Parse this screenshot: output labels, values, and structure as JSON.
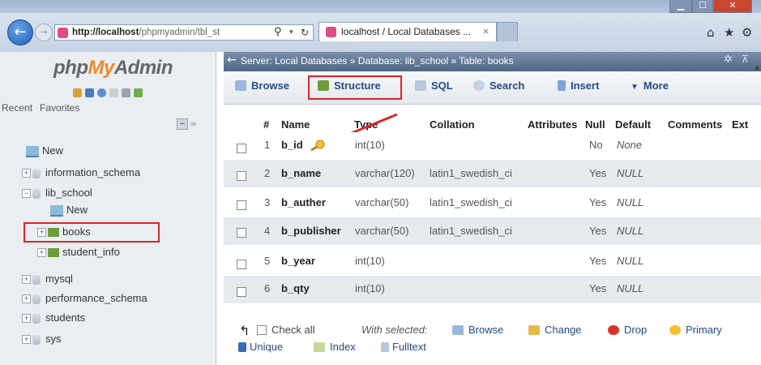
{
  "browser": {
    "url_host": "http://localhost",
    "url_path": "/phpmyadmin/tbl_st",
    "tab_title": "localhost / Local Databases ...",
    "tab_close": "×",
    "back_glyph": "←",
    "fwd_glyph": "→",
    "search_glyph": "⚲",
    "drop_glyph": "▾",
    "refresh_glyph": "↻",
    "home_icon": "⌂",
    "star_icon": "★",
    "gear_icon": "⚙",
    "min_glyph": "▁",
    "max_glyph": "☐",
    "close_glyph": "✕"
  },
  "sidebar": {
    "logo_php": "php",
    "logo_my": "My",
    "logo_admin": "Admin",
    "tabs": [
      "Recent",
      "Favorites"
    ],
    "collapse_glyph": "–",
    "link_glyph": "∞",
    "tree": [
      {
        "label": "New",
        "level": 0,
        "kind": "new"
      },
      {
        "label": "information_schema",
        "level": 0,
        "kind": "db"
      },
      {
        "label": "lib_school",
        "level": 0,
        "kind": "db",
        "expanded": true
      },
      {
        "label": "New",
        "level": 1,
        "kind": "new"
      },
      {
        "label": "books",
        "level": 1,
        "kind": "table",
        "selected": true
      },
      {
        "label": "student_info",
        "level": 1,
        "kind": "table"
      },
      {
        "label": "mysql",
        "level": 0,
        "kind": "db"
      },
      {
        "label": "performance_schema",
        "level": 0,
        "kind": "db"
      },
      {
        "label": "students",
        "level": 0,
        "kind": "db"
      },
      {
        "label": "sys",
        "level": 0,
        "kind": "db"
      }
    ]
  },
  "breadcrumb": {
    "arrow": "←",
    "text": "Server: Local Databases » Database: lib_school » Table: books",
    "gear": "✲",
    "collapse": "⊼",
    "scroll_up": "▲"
  },
  "menu": {
    "browse": "Browse",
    "structure": "Structure",
    "sql": "SQL",
    "search": "Search",
    "insert": "Insert",
    "more": "More",
    "more_glyph": "▼"
  },
  "table": {
    "headers": {
      "num": "#",
      "name": "Name",
      "type": "Type",
      "collation": "Collation",
      "attributes": "Attributes",
      "null": "Null",
      "default": "Default",
      "comments": "Comments",
      "extra": "Ext"
    },
    "rows": [
      {
        "num": "1",
        "name": "b_id",
        "type": "int(10)",
        "collation": "",
        "null": "No",
        "default": "None",
        "primary": true
      },
      {
        "num": "2",
        "name": "b_name",
        "type": "varchar(120)",
        "collation": "latin1_swedish_ci",
        "null": "Yes",
        "default": "NULL"
      },
      {
        "num": "3",
        "name": "b_auther",
        "type": "varchar(50)",
        "collation": "latin1_swedish_ci",
        "null": "Yes",
        "default": "NULL"
      },
      {
        "num": "4",
        "name": "b_publisher",
        "type": "varchar(50)",
        "collation": "latin1_swedish_ci",
        "null": "Yes",
        "default": "NULL"
      },
      {
        "num": "5",
        "name": "b_year",
        "type": "int(10)",
        "collation": "",
        "null": "Yes",
        "default": "NULL"
      },
      {
        "num": "6",
        "name": "b_qty",
        "type": "int(10)",
        "collation": "",
        "null": "Yes",
        "default": "NULL"
      }
    ]
  },
  "footer": {
    "check_all": "Check all",
    "with_selected": "With selected:",
    "browse": "Browse",
    "change": "Change",
    "drop": "Drop",
    "primary": "Primary",
    "unique": "Unique",
    "index": "Index",
    "fulltext": "Fulltext",
    "select_arrow": "↰"
  },
  "colors": {
    "highlight": "#e02424",
    "link": "#234b84",
    "logo_orange": "#f28a20"
  }
}
